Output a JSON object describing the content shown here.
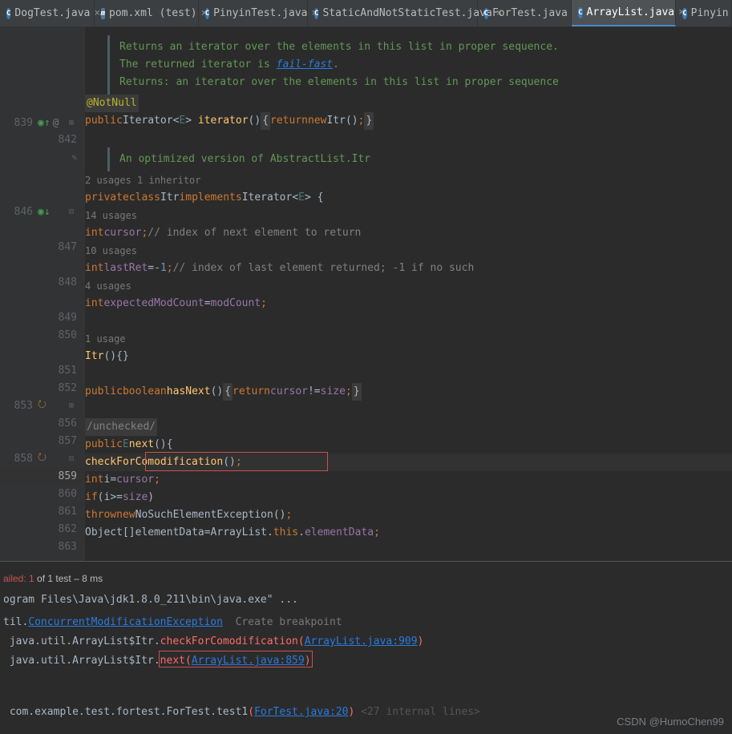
{
  "tabs": [
    {
      "label": "DogTest.java",
      "active": false,
      "closeable": true,
      "type": "class"
    },
    {
      "label": "pom.xml (test)",
      "active": false,
      "closeable": true,
      "type": "maven"
    },
    {
      "label": "PinyinTest.java",
      "active": false,
      "closeable": true,
      "type": "class"
    },
    {
      "label": "StaticAndNotStaticTest.java",
      "active": false,
      "closeable": true,
      "type": "class"
    },
    {
      "label": "ForTest.java",
      "active": false,
      "closeable": true,
      "type": "class"
    },
    {
      "label": "ArrayList.java",
      "active": true,
      "closeable": true,
      "type": "class"
    },
    {
      "label": "Pinyin",
      "active": false,
      "closeable": false,
      "type": "class"
    }
  ],
  "doc": {
    "line1": "Returns an iterator over the elements in this list in proper sequence.",
    "line2a": "The returned iterator is ",
    "line2b": "fail-fast",
    "line2c": ".",
    "line3": " Returns: an iterator over the elements in this list in proper sequence",
    "doc2": "An optimized version of AbstractList.Itr"
  },
  "annotations": {
    "notnull": "@NotNull"
  },
  "gutter": {
    "lines": [
      "839",
      "842",
      "",
      "",
      "",
      "",
      "846",
      "",
      "847",
      "",
      "848",
      "",
      "849",
      "850",
      "",
      "851",
      "852",
      "853",
      "856",
      "857",
      "858",
      "859",
      "860",
      "861",
      "862",
      "863"
    ],
    "current": "859"
  },
  "usages": {
    "u1": "2 usages   1 inheritor",
    "u2": "14 usages",
    "u3": "10 usages",
    "u4": "4 usages",
    "u5": "1 usage"
  },
  "code": {
    "l839": {
      "kw1": "public",
      "type": "Iterator",
      "gen": "E",
      "ident": "iterator",
      "kw2": "return",
      "kw3": "new",
      "call": "Itr"
    },
    "l846": {
      "kw1": "private",
      "kw2": "class",
      "name": "Itr",
      "kw3": "implements",
      "type": "Iterator",
      "gen": "E"
    },
    "l847": {
      "kw": "int",
      "field": "cursor",
      "comment": "// index of next element to return"
    },
    "l848": {
      "kw": "int",
      "field": "lastRet",
      "eq": "=",
      "neg": "-",
      "num": "1",
      "comment": "// index of last element returned; -1 if no such"
    },
    "l849": {
      "kw": "int",
      "field": "expectedModCount",
      "eq": "=",
      "rhs": "modCount"
    },
    "l851": {
      "name": "Itr"
    },
    "l853": {
      "kw1": "public",
      "kw2": "boolean",
      "ident": "hasNext",
      "kw3": "return",
      "field1": "cursor",
      "op": "!=",
      "field2": "size"
    },
    "l857": {
      "text": "/unchecked/"
    },
    "l858": {
      "kw1": "public",
      "gen": "E",
      "ident": "next"
    },
    "l859": {
      "call": "checkForComodification"
    },
    "l860": {
      "kw": "int",
      "var": "i",
      "eq": "=",
      "field": "cursor"
    },
    "l861": {
      "kw": "if",
      "var": "i",
      "op": ">=",
      "field": "size"
    },
    "l862": {
      "kw1": "throw",
      "kw2": "new",
      "type": "NoSuchElementException"
    },
    "l863": {
      "type1": "Object",
      "var": "elementData",
      "eq": "=",
      "type2": "ArrayList",
      "kw": "this",
      "field": "elementData"
    }
  },
  "console": {
    "header_fail": "ailed: 1",
    "header_rest": " of 1 test – 8 ms",
    "l1": "ogram Files\\Java\\jdk1.8.0_211\\bin\\java.exe\" ...",
    "l2a": "til.",
    "l2b": "ConcurrentModificationException",
    "l2c": "Create breakpoint",
    "l3a": " java.util.ArrayList$Itr.",
    "l3b": "checkForComodification",
    "l3c": "(",
    "l3d": "ArrayList.java:909",
    "l3e": ")",
    "l4a": " java.util.ArrayList$Itr.",
    "l4b": "next",
    "l4c": "(",
    "l4d": "ArrayList.java:859",
    "l4e": ")",
    "l5a": " com.example.test.fortest.ForTest.test1",
    "l5b": "(",
    "l5c": "ForTest.java:20",
    "l5d": ")",
    "l5e": " <27 internal lines>"
  },
  "watermark": "CSDN @HumoChen99"
}
